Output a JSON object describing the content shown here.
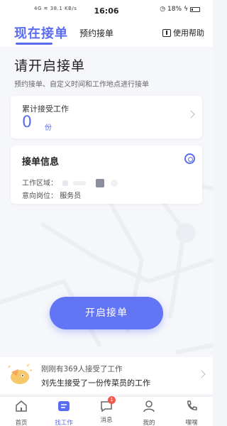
{
  "status_bar": {
    "network": "4G",
    "speed": "38.1 KB/s",
    "time": "16:06",
    "battery": "18%"
  },
  "header": {
    "tab_active": "现在接单",
    "tab_other": "预约接单",
    "help_label": "使用帮助"
  },
  "main": {
    "title": "请开启接单",
    "subtitle": "预约接单、自定义时间和工作地点进行接单"
  },
  "total_card": {
    "label": "累计接受工作",
    "count": "0",
    "unit": "份"
  },
  "info_card": {
    "title": "接单信息",
    "area_label": "工作区域：",
    "position_label": "意向岗位：",
    "position_value": "服务员"
  },
  "start_button": "开启接单",
  "notice": {
    "line1": "刚刚有369人接受了工作",
    "line2": "刘先生接受了一份传菜员的工作"
  },
  "tabbar": {
    "items": [
      {
        "label": "首页",
        "icon": "home-icon"
      },
      {
        "label": "找工作",
        "icon": "find-job-icon"
      },
      {
        "label": "消息",
        "icon": "message-icon",
        "badge": "1"
      },
      {
        "label": "我的",
        "icon": "profile-icon"
      },
      {
        "label": "嘿嘿",
        "icon": "phone-icon"
      }
    ]
  },
  "colors": {
    "accent": "#5a6cf0",
    "button": "#6175f5",
    "badge": "#f25a4f"
  }
}
